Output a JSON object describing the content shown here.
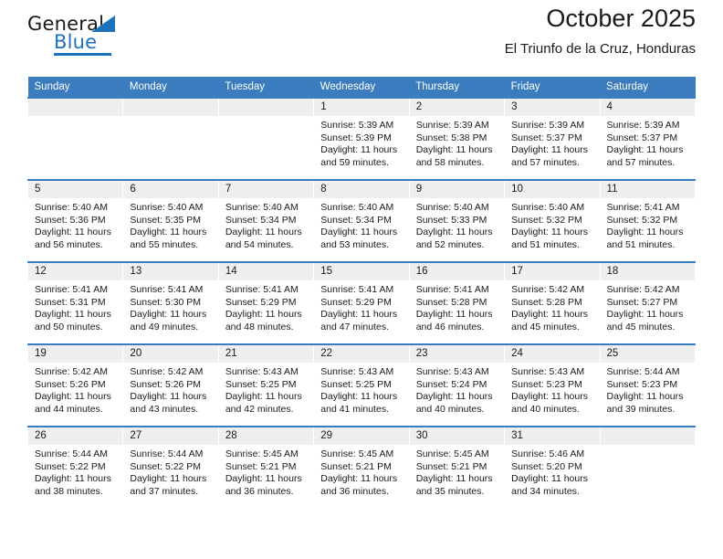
{
  "brand": {
    "name_part1": "General",
    "name_part2": "Blue",
    "triangle_color": "#1f72bd",
    "accent_color": "#1f72bd"
  },
  "header": {
    "title": "October 2025",
    "subtitle": "El Triunfo de la Cruz, Honduras"
  },
  "colors": {
    "header_row_background": "#3a7cbe",
    "header_row_text": "#ffffff",
    "daynum_background": "#efefef",
    "cell_background": "#ffffff",
    "text": "#1a1a1a"
  },
  "calendar": {
    "weekday_headers": [
      "Sunday",
      "Monday",
      "Tuesday",
      "Wednesday",
      "Thursday",
      "Friday",
      "Saturday"
    ],
    "labels": {
      "sunrise": "Sunrise:",
      "sunset": "Sunset:",
      "daylight": "Daylight:"
    },
    "weeks": [
      [
        {
          "day": "",
          "blank": true,
          "line1": "",
          "line2": "",
          "line3": "",
          "line4": ""
        },
        {
          "day": "",
          "blank": true,
          "line1": "",
          "line2": "",
          "line3": "",
          "line4": ""
        },
        {
          "day": "",
          "blank": true,
          "line1": "",
          "line2": "",
          "line3": "",
          "line4": ""
        },
        {
          "day": "1",
          "blank": false,
          "line1": "Sunrise: 5:39 AM",
          "line2": "Sunset: 5:39 PM",
          "line3": "Daylight: 11 hours",
          "line4": "and 59 minutes."
        },
        {
          "day": "2",
          "blank": false,
          "line1": "Sunrise: 5:39 AM",
          "line2": "Sunset: 5:38 PM",
          "line3": "Daylight: 11 hours",
          "line4": "and 58 minutes."
        },
        {
          "day": "3",
          "blank": false,
          "line1": "Sunrise: 5:39 AM",
          "line2": "Sunset: 5:37 PM",
          "line3": "Daylight: 11 hours",
          "line4": "and 57 minutes."
        },
        {
          "day": "4",
          "blank": false,
          "line1": "Sunrise: 5:39 AM",
          "line2": "Sunset: 5:37 PM",
          "line3": "Daylight: 11 hours",
          "line4": "and 57 minutes."
        }
      ],
      [
        {
          "day": "5",
          "blank": false,
          "line1": "Sunrise: 5:40 AM",
          "line2": "Sunset: 5:36 PM",
          "line3": "Daylight: 11 hours",
          "line4": "and 56 minutes."
        },
        {
          "day": "6",
          "blank": false,
          "line1": "Sunrise: 5:40 AM",
          "line2": "Sunset: 5:35 PM",
          "line3": "Daylight: 11 hours",
          "line4": "and 55 minutes."
        },
        {
          "day": "7",
          "blank": false,
          "line1": "Sunrise: 5:40 AM",
          "line2": "Sunset: 5:34 PM",
          "line3": "Daylight: 11 hours",
          "line4": "and 54 minutes."
        },
        {
          "day": "8",
          "blank": false,
          "line1": "Sunrise: 5:40 AM",
          "line2": "Sunset: 5:34 PM",
          "line3": "Daylight: 11 hours",
          "line4": "and 53 minutes."
        },
        {
          "day": "9",
          "blank": false,
          "line1": "Sunrise: 5:40 AM",
          "line2": "Sunset: 5:33 PM",
          "line3": "Daylight: 11 hours",
          "line4": "and 52 minutes."
        },
        {
          "day": "10",
          "blank": false,
          "line1": "Sunrise: 5:40 AM",
          "line2": "Sunset: 5:32 PM",
          "line3": "Daylight: 11 hours",
          "line4": "and 51 minutes."
        },
        {
          "day": "11",
          "blank": false,
          "line1": "Sunrise: 5:41 AM",
          "line2": "Sunset: 5:32 PM",
          "line3": "Daylight: 11 hours",
          "line4": "and 51 minutes."
        }
      ],
      [
        {
          "day": "12",
          "blank": false,
          "line1": "Sunrise: 5:41 AM",
          "line2": "Sunset: 5:31 PM",
          "line3": "Daylight: 11 hours",
          "line4": "and 50 minutes."
        },
        {
          "day": "13",
          "blank": false,
          "line1": "Sunrise: 5:41 AM",
          "line2": "Sunset: 5:30 PM",
          "line3": "Daylight: 11 hours",
          "line4": "and 49 minutes."
        },
        {
          "day": "14",
          "blank": false,
          "line1": "Sunrise: 5:41 AM",
          "line2": "Sunset: 5:29 PM",
          "line3": "Daylight: 11 hours",
          "line4": "and 48 minutes."
        },
        {
          "day": "15",
          "blank": false,
          "line1": "Sunrise: 5:41 AM",
          "line2": "Sunset: 5:29 PM",
          "line3": "Daylight: 11 hours",
          "line4": "and 47 minutes."
        },
        {
          "day": "16",
          "blank": false,
          "line1": "Sunrise: 5:41 AM",
          "line2": "Sunset: 5:28 PM",
          "line3": "Daylight: 11 hours",
          "line4": "and 46 minutes."
        },
        {
          "day": "17",
          "blank": false,
          "line1": "Sunrise: 5:42 AM",
          "line2": "Sunset: 5:28 PM",
          "line3": "Daylight: 11 hours",
          "line4": "and 45 minutes."
        },
        {
          "day": "18",
          "blank": false,
          "line1": "Sunrise: 5:42 AM",
          "line2": "Sunset: 5:27 PM",
          "line3": "Daylight: 11 hours",
          "line4": "and 45 minutes."
        }
      ],
      [
        {
          "day": "19",
          "blank": false,
          "line1": "Sunrise: 5:42 AM",
          "line2": "Sunset: 5:26 PM",
          "line3": "Daylight: 11 hours",
          "line4": "and 44 minutes."
        },
        {
          "day": "20",
          "blank": false,
          "line1": "Sunrise: 5:42 AM",
          "line2": "Sunset: 5:26 PM",
          "line3": "Daylight: 11 hours",
          "line4": "and 43 minutes."
        },
        {
          "day": "21",
          "blank": false,
          "line1": "Sunrise: 5:43 AM",
          "line2": "Sunset: 5:25 PM",
          "line3": "Daylight: 11 hours",
          "line4": "and 42 minutes."
        },
        {
          "day": "22",
          "blank": false,
          "line1": "Sunrise: 5:43 AM",
          "line2": "Sunset: 5:25 PM",
          "line3": "Daylight: 11 hours",
          "line4": "and 41 minutes."
        },
        {
          "day": "23",
          "blank": false,
          "line1": "Sunrise: 5:43 AM",
          "line2": "Sunset: 5:24 PM",
          "line3": "Daylight: 11 hours",
          "line4": "and 40 minutes."
        },
        {
          "day": "24",
          "blank": false,
          "line1": "Sunrise: 5:43 AM",
          "line2": "Sunset: 5:23 PM",
          "line3": "Daylight: 11 hours",
          "line4": "and 40 minutes."
        },
        {
          "day": "25",
          "blank": false,
          "line1": "Sunrise: 5:44 AM",
          "line2": "Sunset: 5:23 PM",
          "line3": "Daylight: 11 hours",
          "line4": "and 39 minutes."
        }
      ],
      [
        {
          "day": "26",
          "blank": false,
          "line1": "Sunrise: 5:44 AM",
          "line2": "Sunset: 5:22 PM",
          "line3": "Daylight: 11 hours",
          "line4": "and 38 minutes."
        },
        {
          "day": "27",
          "blank": false,
          "line1": "Sunrise: 5:44 AM",
          "line2": "Sunset: 5:22 PM",
          "line3": "Daylight: 11 hours",
          "line4": "and 37 minutes."
        },
        {
          "day": "28",
          "blank": false,
          "line1": "Sunrise: 5:45 AM",
          "line2": "Sunset: 5:21 PM",
          "line3": "Daylight: 11 hours",
          "line4": "and 36 minutes."
        },
        {
          "day": "29",
          "blank": false,
          "line1": "Sunrise: 5:45 AM",
          "line2": "Sunset: 5:21 PM",
          "line3": "Daylight: 11 hours",
          "line4": "and 36 minutes."
        },
        {
          "day": "30",
          "blank": false,
          "line1": "Sunrise: 5:45 AM",
          "line2": "Sunset: 5:21 PM",
          "line3": "Daylight: 11 hours",
          "line4": "and 35 minutes."
        },
        {
          "day": "31",
          "blank": false,
          "line1": "Sunrise: 5:46 AM",
          "line2": "Sunset: 5:20 PM",
          "line3": "Daylight: 11 hours",
          "line4": "and 34 minutes."
        },
        {
          "day": "",
          "blank": true,
          "line1": "",
          "line2": "",
          "line3": "",
          "line4": ""
        }
      ]
    ]
  }
}
